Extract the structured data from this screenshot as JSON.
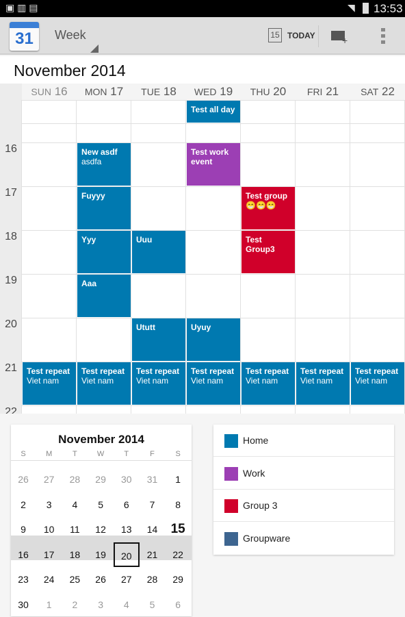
{
  "status": {
    "time": "13:53"
  },
  "appbar": {
    "view": "Week",
    "today_icon_day": "15",
    "today_label": "TODAY",
    "logo_day": "31"
  },
  "month_title": "November 2014",
  "days": [
    {
      "dow": "SUN",
      "day": "16"
    },
    {
      "dow": "MON",
      "day": "17"
    },
    {
      "dow": "TUE",
      "day": "18"
    },
    {
      "dow": "WED",
      "day": "19"
    },
    {
      "dow": "THU",
      "day": "20"
    },
    {
      "dow": "FRI",
      "day": "21"
    },
    {
      "dow": "SAT",
      "day": "22"
    }
  ],
  "hours": [
    "16",
    "17",
    "18",
    "19",
    "20",
    "21",
    "22"
  ],
  "colors": {
    "Home": "#0079b0",
    "Work": "#9c3fb4",
    "Group 3": "#d0002a",
    "Groupware": "#3d6590"
  },
  "all_day": [
    {
      "day": 3,
      "title": "Test all day",
      "calendar": "Home"
    }
  ],
  "events": [
    {
      "day": 1,
      "start": 16,
      "end": 17,
      "title": "New asdf",
      "sub": "asdfa",
      "calendar": "Home"
    },
    {
      "day": 1,
      "start": 17,
      "end": 18,
      "title": "Fuyyy",
      "calendar": "Home"
    },
    {
      "day": 1,
      "start": 18,
      "end": 19,
      "title": "Yyy",
      "calendar": "Home"
    },
    {
      "day": 1,
      "start": 19,
      "end": 20,
      "title": "Aaa",
      "calendar": "Home"
    },
    {
      "day": 2,
      "start": 18,
      "end": 19,
      "title": "Uuu",
      "calendar": "Home"
    },
    {
      "day": 2,
      "start": 20,
      "end": 21,
      "title": "Ututt",
      "calendar": "Home"
    },
    {
      "day": 3,
      "start": 16,
      "end": 17,
      "title": "Test work event",
      "calendar": "Work"
    },
    {
      "day": 3,
      "start": 20,
      "end": 21,
      "title": "Uyuy",
      "calendar": "Home"
    },
    {
      "day": 4,
      "start": 17,
      "end": 18,
      "title": "Test group😁😁😁",
      "calendar": "Group 3"
    },
    {
      "day": 4,
      "start": 18,
      "end": 19,
      "title": "Test Group3",
      "calendar": "Group 3"
    },
    {
      "day": 0,
      "start": 21,
      "end": 22,
      "title": "Test repeat",
      "sub": "Viet nam",
      "calendar": "Home"
    },
    {
      "day": 1,
      "start": 21,
      "end": 22,
      "title": "Test repeat",
      "sub": "Viet nam",
      "calendar": "Home"
    },
    {
      "day": 2,
      "start": 21,
      "end": 22,
      "title": "Test repeat",
      "sub": "Viet nam",
      "calendar": "Home"
    },
    {
      "day": 3,
      "start": 21,
      "end": 22,
      "title": "Test repeat",
      "sub": "Viet nam",
      "calendar": "Home"
    },
    {
      "day": 4,
      "start": 21,
      "end": 22,
      "title": "Test repeat",
      "sub": "Viet nam",
      "calendar": "Home"
    },
    {
      "day": 5,
      "start": 21,
      "end": 22,
      "title": "Test repeat",
      "sub": "Viet nam",
      "calendar": "Home"
    },
    {
      "day": 6,
      "start": 21,
      "end": 22,
      "title": "Test repeat",
      "sub": "Viet nam",
      "calendar": "Home"
    }
  ],
  "mini_calendar": {
    "title": "November 2014",
    "weekdays": [
      "S",
      "M",
      "T",
      "W",
      "T",
      "F",
      "S"
    ],
    "weeks": [
      [
        "26",
        "27",
        "28",
        "29",
        "30",
        "31",
        "1"
      ],
      [
        "2",
        "3",
        "4",
        "5",
        "6",
        "7",
        "8"
      ],
      [
        "9",
        "10",
        "11",
        "12",
        "13",
        "14",
        "15"
      ],
      [
        "16",
        "17",
        "18",
        "19",
        "20",
        "21",
        "22"
      ],
      [
        "23",
        "24",
        "25",
        "26",
        "27",
        "28",
        "29"
      ],
      [
        "30",
        "1",
        "2",
        "3",
        "4",
        "5",
        "6"
      ]
    ],
    "today": "15",
    "selected": "20",
    "selected_week": 3
  },
  "legend": [
    {
      "name": "Home"
    },
    {
      "name": "Work"
    },
    {
      "name": "Group 3"
    },
    {
      "name": "Groupware"
    }
  ]
}
